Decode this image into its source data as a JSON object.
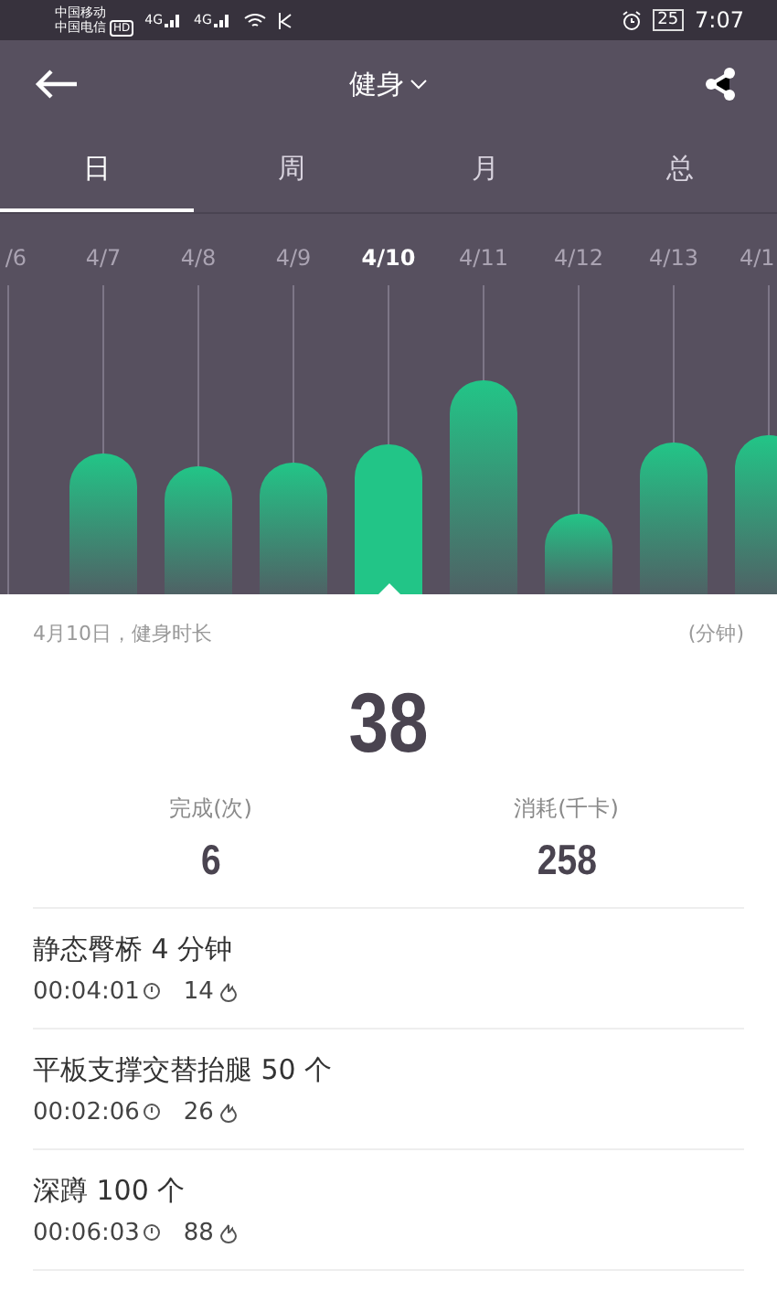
{
  "status_bar": {
    "carriers": [
      "中国移动",
      "中国电信"
    ],
    "hd_badge": "HD",
    "networks": [
      "4G",
      "4G"
    ],
    "battery": "25",
    "time": "7:07"
  },
  "header": {
    "title": "健身"
  },
  "tabs": [
    {
      "label": "日",
      "selected": true
    },
    {
      "label": "周",
      "selected": false
    },
    {
      "label": "月",
      "selected": false
    },
    {
      "label": "总",
      "selected": false
    }
  ],
  "days": [
    {
      "label": "/6",
      "selected": false
    },
    {
      "label": "4/7",
      "selected": false
    },
    {
      "label": "4/8",
      "selected": false
    },
    {
      "label": "4/9",
      "selected": false
    },
    {
      "label": "4/10",
      "selected": true
    },
    {
      "label": "4/11",
      "selected": false
    },
    {
      "label": "4/12",
      "selected": false
    },
    {
      "label": "4/13",
      "selected": false
    },
    {
      "label": "4/1",
      "selected": false
    }
  ],
  "summary": {
    "caption": "4月10日，健身时长",
    "unit": "(分钟)",
    "value": "38"
  },
  "stats": [
    {
      "label": "完成(次)",
      "value": "6"
    },
    {
      "label": "消耗(千卡)",
      "value": "258"
    }
  ],
  "workouts": [
    {
      "name": "静态臀桥 4 分钟",
      "duration": "00:04:01",
      "calories": "14"
    },
    {
      "name": "平板支撑交替抬腿 50 个",
      "duration": "00:02:06",
      "calories": "26"
    },
    {
      "name": "深蹲 100 个",
      "duration": "00:06:03",
      "calories": "88"
    }
  ]
}
